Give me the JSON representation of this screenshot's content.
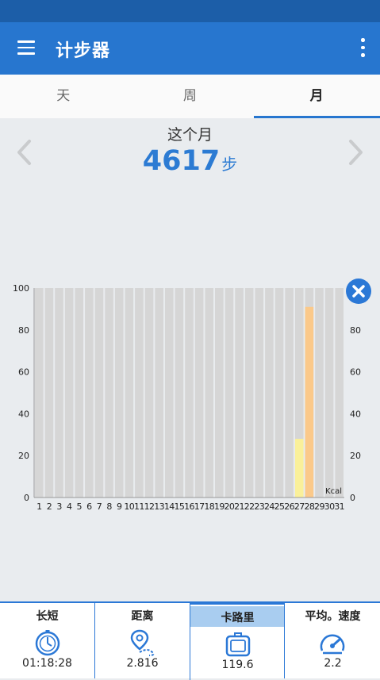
{
  "app": {
    "title": "计步器"
  },
  "tabs": [
    {
      "label": "天"
    },
    {
      "label": "周"
    },
    {
      "label": "月"
    }
  ],
  "summary": {
    "period": "这个月",
    "steps": "4617",
    "steps_unit": "步"
  },
  "colors": {
    "primary": "#2776cf",
    "status_bar": "#1c5ea8",
    "bar_light": "#faf09a",
    "bar_orange": "#fbc98a",
    "bar_background": "#d6d6d6"
  },
  "chart_data": {
    "type": "bar",
    "categories": [
      "1",
      "2",
      "3",
      "4",
      "5",
      "6",
      "7",
      "8",
      "9",
      "10",
      "11",
      "12",
      "13",
      "14",
      "15",
      "16",
      "17",
      "18",
      "19",
      "20",
      "21",
      "22",
      "23",
      "24",
      "25",
      "26",
      "27",
      "28",
      "29",
      "30",
      "31"
    ],
    "values": [
      0,
      0,
      0,
      0,
      0,
      0,
      0,
      0,
      0,
      0,
      0,
      0,
      0,
      0,
      0,
      0,
      0,
      0,
      0,
      0,
      0,
      0,
      0,
      0,
      0,
      0,
      28,
      91,
      0,
      0,
      0
    ],
    "ylim": [
      0,
      100
    ],
    "yticks": [
      0,
      20,
      40,
      60,
      80,
      100
    ],
    "right_yticks": [
      0,
      20,
      40,
      60,
      80
    ],
    "unit_label": "Kcal",
    "grid": false
  },
  "bottom_stats": [
    {
      "label": "长短",
      "value": "01:18:28",
      "icon": "stopwatch-icon"
    },
    {
      "label": "距离",
      "value": "2.816",
      "icon": "route-pin-icon"
    },
    {
      "label": "卡路里",
      "value": "119.6",
      "icon": "scale-icon"
    },
    {
      "label": "平均。速度",
      "value": "2.2",
      "icon": "speedometer-icon"
    }
  ]
}
